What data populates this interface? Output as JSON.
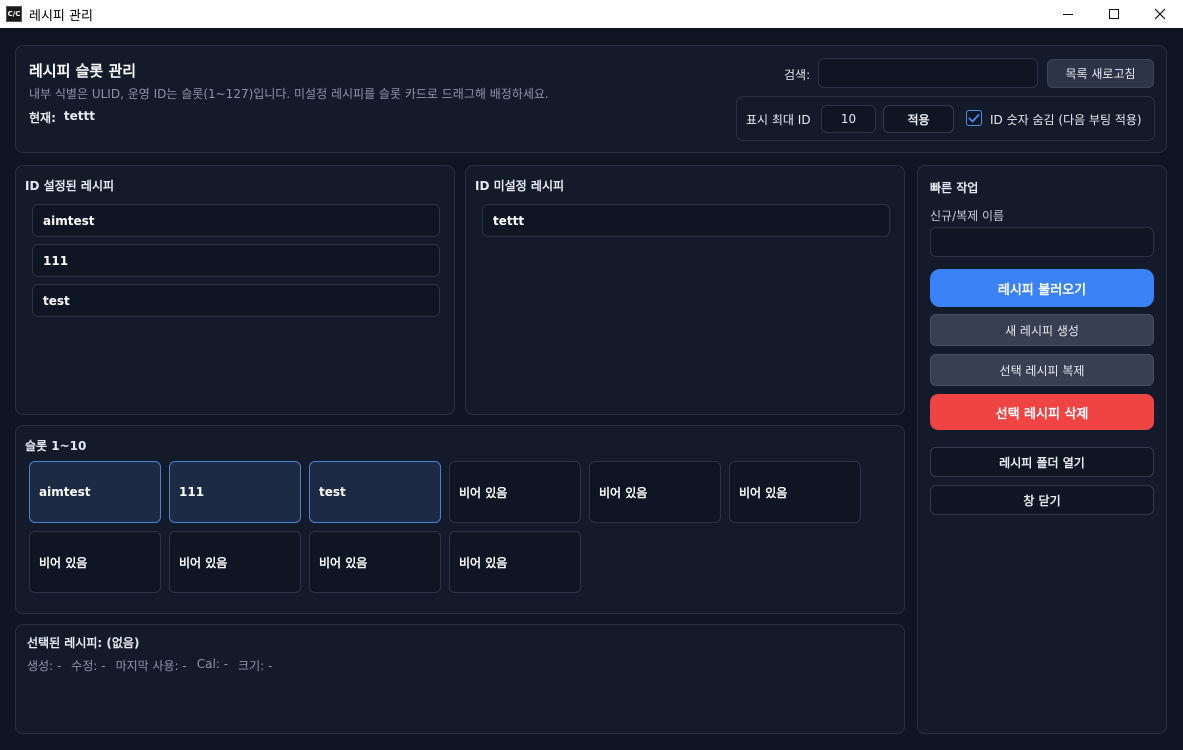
{
  "window": {
    "title": "레시피 관리",
    "icon_label": "C/C"
  },
  "header": {
    "title": "레시피 슬롯 관리",
    "description": "내부 식별은 ULID, 운영 ID는 슬롯(1~127)입니다. 미설정 레시피를 슬롯 카드로 드래그해 배정하세요.",
    "current_label": "현재:",
    "current_value": "tettt",
    "search_label": "검색:",
    "search_value": "",
    "refresh_button": "목록 새로고침",
    "max_id_label": "표시 최대 ID",
    "max_id_value": "10",
    "apply_button": "적용",
    "hide_id_label": "ID 숫자 숨김 (다음 부팅 적용)",
    "hide_id_checked": true
  },
  "assigned": {
    "title": "ID 설정된 레시피",
    "items": [
      "aimtest",
      "111",
      "test"
    ]
  },
  "unassigned": {
    "title": "ID 미설정 레시피",
    "items": [
      "tettt"
    ]
  },
  "slots": {
    "title": "슬롯 1~10",
    "items": [
      {
        "label": "aimtest",
        "filled": true
      },
      {
        "label": "111",
        "filled": true
      },
      {
        "label": "test",
        "filled": true
      },
      {
        "label": "비어 있음",
        "filled": false
      },
      {
        "label": "비어 있음",
        "filled": false
      },
      {
        "label": "비어 있음",
        "filled": false
      },
      {
        "label": "비어 있음",
        "filled": false
      },
      {
        "label": "비어 있음",
        "filled": false
      },
      {
        "label": "비어 있음",
        "filled": false
      },
      {
        "label": "비어 있음",
        "filled": false
      }
    ]
  },
  "selected": {
    "title": "선택된 레시피: (없음)",
    "created": "생성: -",
    "modified": "수정: -",
    "last_used": "마지막 사용: -",
    "cal": "Cal: -",
    "size": "크기: -"
  },
  "quick": {
    "title": "빠른 작업",
    "name_label": "신규/복제 이름",
    "name_value": "",
    "load_button": "레시피 불러오기",
    "new_button": "새 레시피 생성",
    "duplicate_button": "선택 레시피 복제",
    "delete_button": "선택 레시피 삭제",
    "open_folder_button": "레시피 폴더 열기",
    "close_button": "창 닫기"
  },
  "colors": {
    "accent": "#3b82f6",
    "danger": "#ef4444",
    "background": "#0f1623",
    "panel": "#131b2a"
  }
}
